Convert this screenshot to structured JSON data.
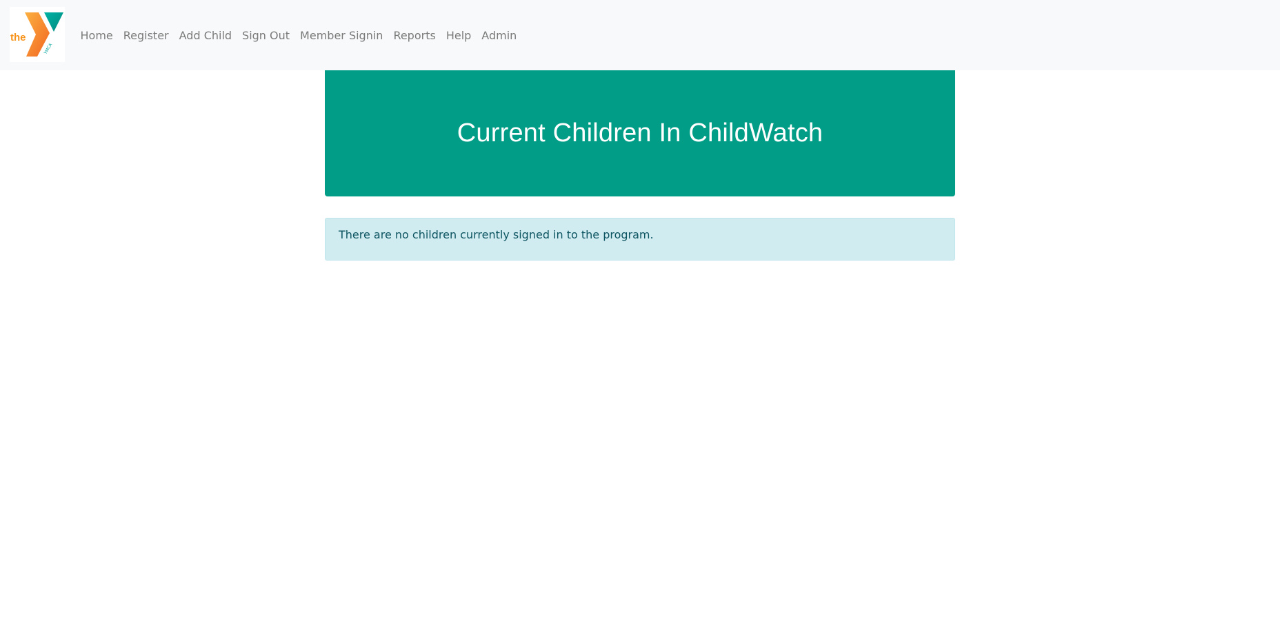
{
  "brand": {
    "logo_text": "the",
    "logo_subtext": "YMCA",
    "colors": {
      "orange": "#f7941d",
      "teal": "#00a39b"
    }
  },
  "nav": {
    "items": [
      {
        "label": "Home"
      },
      {
        "label": "Register"
      },
      {
        "label": "Add Child"
      },
      {
        "label": "Sign Out"
      },
      {
        "label": "Member Signin"
      },
      {
        "label": "Reports"
      },
      {
        "label": "Help"
      },
      {
        "label": "Admin"
      }
    ]
  },
  "header": {
    "title": "Current Children In ChildWatch",
    "color": "#029d86"
  },
  "alert": {
    "message": "There are no children currently signed in to the program.",
    "color": "#d1ecf1"
  }
}
